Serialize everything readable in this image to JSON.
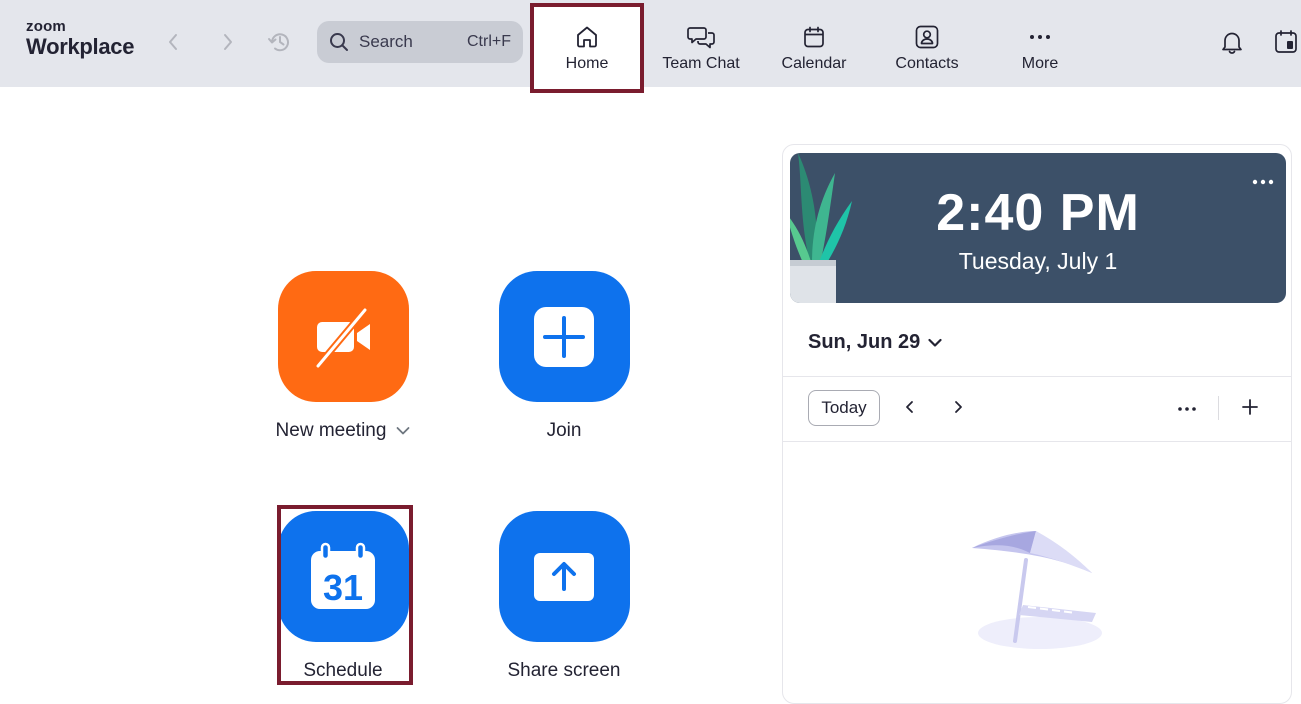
{
  "app": {
    "brand_small": "zoom",
    "brand_large": "Workplace"
  },
  "search": {
    "label": "Search",
    "shortcut": "Ctrl+F"
  },
  "tabs": [
    {
      "label": "Home",
      "icon": "home-icon",
      "active": true
    },
    {
      "label": "Team Chat",
      "icon": "chat-icon"
    },
    {
      "label": "Calendar",
      "icon": "calendar-icon"
    },
    {
      "label": "Contacts",
      "icon": "contacts-icon"
    },
    {
      "label": "More",
      "icon": "more-icon"
    }
  ],
  "actions": {
    "new_meeting": "New meeting",
    "join": "Join",
    "schedule": "Schedule",
    "schedule_day": "31",
    "share_screen": "Share screen"
  },
  "clock": {
    "time": "2:40 PM",
    "date": "Tuesday, July 1"
  },
  "calendar": {
    "selected_date": "Sun, Jun 29",
    "today_label": "Today"
  },
  "colors": {
    "accent_blue": "#0e72ed",
    "accent_orange": "#ff6a13",
    "highlight": "#7a1c2e",
    "card_bg": "#3c5068"
  }
}
